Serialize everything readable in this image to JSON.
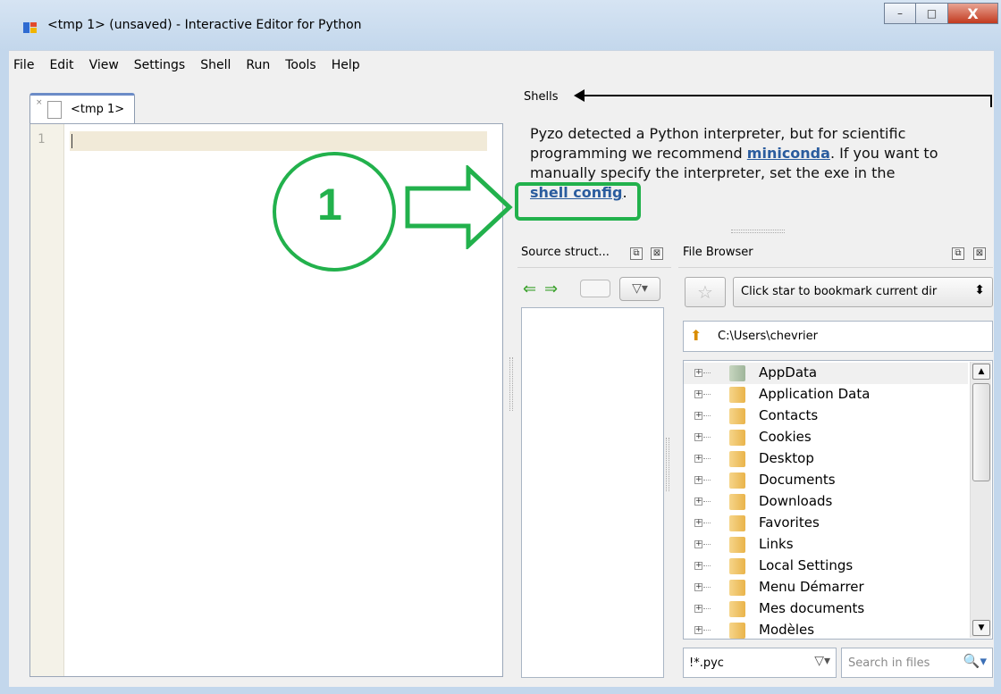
{
  "window": {
    "title": "<tmp 1> (unsaved) - Interactive Editor for Python",
    "minimize_glyph": "–",
    "maximize_glyph": "□",
    "close_glyph": "X"
  },
  "menu": [
    "File",
    "Edit",
    "View",
    "Settings",
    "Shell",
    "Run",
    "Tools",
    "Help"
  ],
  "editor": {
    "tab_label": "<tmp 1>",
    "tab_close_glyph": "×",
    "line_number": "1"
  },
  "shells": {
    "title": "Shells",
    "message": {
      "line1": "Pyzo detected a Python interpreter, but for scientific",
      "line2_pre": "programming we recommend ",
      "line2_link": "miniconda",
      "line2_post": ". If you want to",
      "line3": "manually specify the interpreter, set the exe in the",
      "line4_link": "shell config",
      "line4_post": "."
    }
  },
  "source_structure": {
    "title": "Source struct...",
    "back_glyph": "⇐",
    "forward_glyph": "⇒"
  },
  "file_browser": {
    "title": "File Browser",
    "star_glyph": "☆",
    "bookmark_text": "Click star to bookmark current dir",
    "bookmark_spin_glyph": "⬍",
    "path": "C:\\Users\\chevrier",
    "up_glyph": "⬆",
    "items": [
      "AppData",
      "Application Data",
      "Contacts",
      "Cookies",
      "Desktop",
      "Documents",
      "Downloads",
      "Favorites",
      "Links",
      "Local Settings",
      "Menu Démarrer",
      "Mes documents",
      "Modèles"
    ],
    "filter_value": "!*.pyc",
    "filter_glyph": "▽▾",
    "search_placeholder": "Search in files",
    "search_glyph": "🔍▾"
  },
  "dock_float_glyph": "⧉",
  "dock_close_glyph": "⊠",
  "annotation": {
    "number": "1",
    "color": "#22b14c"
  },
  "colors": {
    "link": "#2a5c9e",
    "current_line": "#f1ead8",
    "gutter": "#f4f2e8",
    "annotation_green": "#22b14c"
  }
}
